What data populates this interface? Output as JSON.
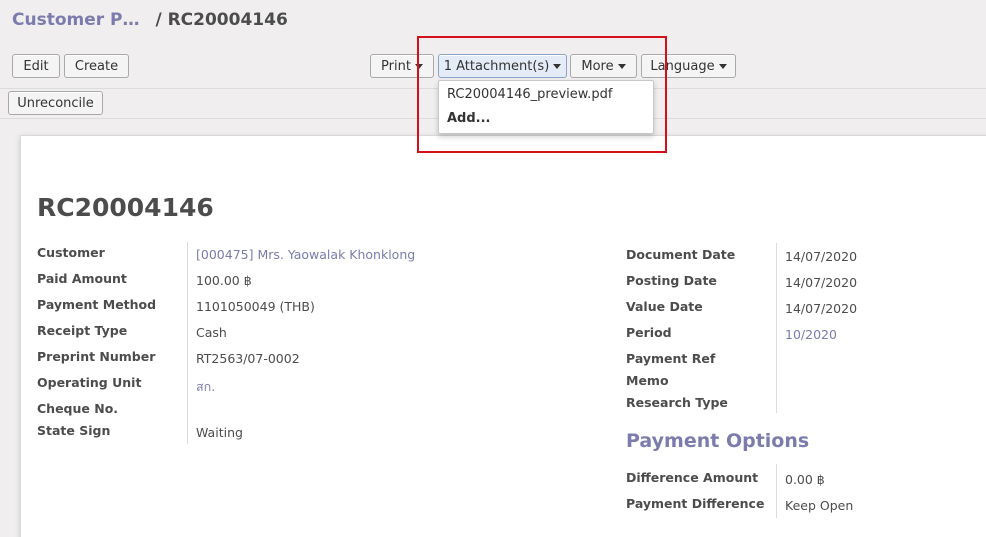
{
  "breadcrumb": {
    "parent": "Customer P…",
    "separator": "/",
    "current": "RC20004146"
  },
  "toolbar": {
    "edit": "Edit",
    "create": "Create",
    "print": "Print",
    "attachments": "1 Attachment(s)",
    "more": "More",
    "language": "Language",
    "unreconcile": "Unreconcile"
  },
  "attachments_menu": {
    "file": "RC20004146_preview.pdf",
    "add": "Add..."
  },
  "record": {
    "title": "RC20004146",
    "left_fields": [
      {
        "label": "Customer",
        "value": "[000475] Mrs. Yaowalak Khonklong"
      },
      {
        "label": "Paid Amount",
        "value": "100.00 ฿"
      },
      {
        "label": "Payment Method",
        "value": "1101050049 (THB)"
      },
      {
        "label": "Receipt Type",
        "value": "Cash"
      },
      {
        "label": "Preprint Number",
        "value": "RT2563/07-0002"
      },
      {
        "label": "Operating Unit",
        "value": "สก."
      },
      {
        "label": "Cheque No.",
        "value": ""
      },
      {
        "label": "State Sign",
        "value": "Waiting"
      }
    ],
    "right_fields": [
      {
        "label": "Document Date",
        "value": "14/07/2020"
      },
      {
        "label": "Posting Date",
        "value": "14/07/2020"
      },
      {
        "label": "Value Date",
        "value": "14/07/2020"
      },
      {
        "label": "Period",
        "value": "10/2020"
      },
      {
        "label": "Payment Ref",
        "value": ""
      },
      {
        "label": "Memo",
        "value": ""
      },
      {
        "label": "Research Type",
        "value": ""
      }
    ],
    "payment_options": {
      "title": "Payment Options",
      "fields": [
        {
          "label": "Difference Amount",
          "value": "0.00 ฿"
        },
        {
          "label": "Payment Difference",
          "value": "Keep Open"
        }
      ]
    }
  },
  "colors": {
    "link": "#7c7bad",
    "highlight": "#d4111b",
    "text": "#4c4c4c"
  }
}
